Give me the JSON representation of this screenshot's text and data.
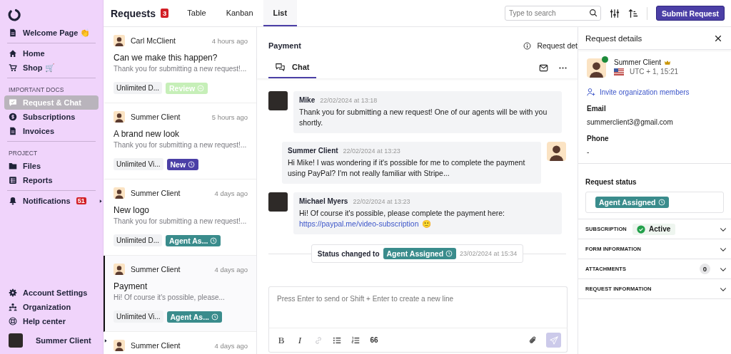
{
  "sidebar": {
    "groups": [
      {
        "items": [
          {
            "label": "Welcome Page 👏",
            "selected": false
          }
        ]
      },
      {
        "items": [
          {
            "label": "Home",
            "selected": false
          },
          {
            "label": "Shop 🛒",
            "selected": false
          }
        ]
      },
      {
        "heading": "IMPORTANT DOCS",
        "items": [
          {
            "label": "Request & Chat",
            "selected": true
          },
          {
            "label": "Subscriptions",
            "selected": false
          },
          {
            "label": "Invoices",
            "selected": false
          }
        ]
      },
      {
        "heading": "PROJECT",
        "items": [
          {
            "label": "Files",
            "selected": false
          },
          {
            "label": "Reports",
            "selected": false
          }
        ]
      },
      {
        "items": [
          {
            "label": "Notifications",
            "badge": "51",
            "selected": false
          }
        ]
      }
    ],
    "bottom_items": [
      {
        "label": "Account Settings",
        "selected": false
      },
      {
        "label": "Organization",
        "selected": false
      },
      {
        "label": "Help center",
        "selected": false
      }
    ],
    "user": {
      "name": "Summer Client"
    }
  },
  "header": {
    "title": "Requests",
    "count": "3",
    "tabs": [
      {
        "label": "Table",
        "selected": false
      },
      {
        "label": "Kanban",
        "selected": false
      },
      {
        "label": "List",
        "selected": true
      }
    ],
    "search": {
      "placeholder": "Type to search"
    },
    "submit_button": "Submit Request"
  },
  "requests": [
    {
      "author": "Carl McClient",
      "time": "4 hours ago",
      "title": "Can we make this happen?",
      "preview": "Thank you for submitting a new request!...",
      "plan": "Unlimited D...",
      "status": {
        "label": "Review",
        "kind": "review",
        "color": "#c6efb8"
      },
      "selected": false
    },
    {
      "author": "Summer Client",
      "time": "5 hours ago",
      "title": "A brand new look",
      "preview": "Thank you for submitting a new request!...",
      "plan": "Unlimited Vi...",
      "status": {
        "label": "New",
        "kind": "timed",
        "color": "#4b3fa6"
      },
      "selected": false
    },
    {
      "author": "Summer Client",
      "time": "4 days ago",
      "title": "New logo",
      "preview": "Thank you for submitting a new request!...",
      "plan": "Unlimited D...",
      "status": {
        "label": "Agent As...",
        "kind": "timed",
        "color": "#3a8c8c"
      },
      "selected": false
    },
    {
      "author": "Summer Client",
      "time": "4 days ago",
      "title": "Payment",
      "preview": "Hi! Of course it's possible, please...",
      "plan": "Unlimited Vi...",
      "status": {
        "label": "Agent As...",
        "kind": "timed",
        "color": "#3a8c8c"
      },
      "selected": true
    },
    {
      "author": "Summer Client",
      "time": "4 days ago",
      "selected": false
    }
  ],
  "chat": {
    "title": "Payment",
    "details_link": "Request det",
    "tabs": [
      {
        "label": "Chat",
        "selected": true
      }
    ],
    "messages": [
      {
        "author": "Mike",
        "kind": "agent",
        "time": "22/02/2024 at 13:18",
        "text": "Thank you for submitting a new request! One of our agents will be with you shortly."
      },
      {
        "author": "Summer Client",
        "kind": "client",
        "time": "22/02/2024 at 13:23",
        "text": "Hi Mike! I was wondering if it's possible for me to complete the payment using PayPal? I'm not really familiar with Stripe..."
      },
      {
        "author": "Michael Myers",
        "kind": "agent",
        "time": "22/02/2024 at 13:23",
        "text": "Hi! Of course it's possible, please complete the payment here:",
        "link": "https://paypal.me/video-subscription",
        "emoji": "🙂"
      }
    ],
    "status_change": {
      "label": "Status changed to",
      "status": "Agent Assigned",
      "color": "#3a8c8c",
      "time": "23/02/2024 at 15:34"
    },
    "composer": {
      "placeholder": "Press Enter to send or Shift + Enter to create a new line",
      "format_buttons": [
        {
          "kind": "bold",
          "label": "B",
          "disabled": false
        },
        {
          "kind": "italic",
          "label": "I",
          "disabled": false
        },
        {
          "kind": "link",
          "disabled": true
        },
        {
          "kind": "bullets",
          "disabled": false
        },
        {
          "kind": "numbers",
          "disabled": false
        },
        {
          "kind": "quote",
          "label": "66",
          "disabled": false
        }
      ],
      "send_disabled": true
    }
  },
  "details": {
    "title": "Request details",
    "user": {
      "name": "Summer Client",
      "timezone": "UTC + 1, 15:21",
      "online": true
    },
    "invite_link": "Invite organization members",
    "email_label": "Email",
    "email": "summerclient3@gmail.com",
    "phone_label": "Phone",
    "phone": "-",
    "status_label": "Request status",
    "status": {
      "label": "Agent Assigned",
      "color": "#3a8c8c"
    },
    "sections": [
      {
        "title": "SUBSCRIPTION",
        "badge": "Active",
        "expanded": false
      },
      {
        "title": "FORM INFORMATION",
        "expanded": false
      },
      {
        "title": "ATTACHMENTS",
        "count": "0",
        "expanded": false
      },
      {
        "title": "REQUEST INFORMATION",
        "expanded": false
      }
    ]
  }
}
